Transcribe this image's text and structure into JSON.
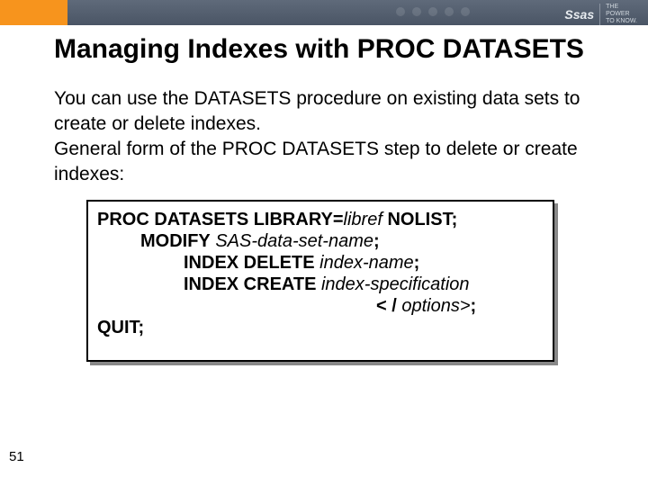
{
  "header": {
    "brand": "Ssas",
    "tagline_line1": "THE",
    "tagline_line2": "POWER",
    "tagline_line3": "TO KNOW."
  },
  "slide": {
    "title": "Managing Indexes with PROC DATASETS",
    "para1": "You can use the DATASETS procedure on existing data sets to create or delete indexes.",
    "para2": "General form of the PROC DATASETS step to delete or create indexes:",
    "code": {
      "l1a": "PROC DATASETS LIBRARY=",
      "l1b": "libref ",
      "l1c": "NOLIST;",
      "l2a": "MODIFY",
      "l2b": " SAS-data-set-name",
      "l2c": ";",
      "l3a": "INDEX DELETE",
      "l3b": " index-name",
      "l3c": ";",
      "l4a": "INDEX CREATE",
      "l4b": " index-specification",
      "l5a": "< / ",
      "l5b": "options>",
      "l5c": ";",
      "l6": "QUIT;"
    },
    "page": "51"
  }
}
